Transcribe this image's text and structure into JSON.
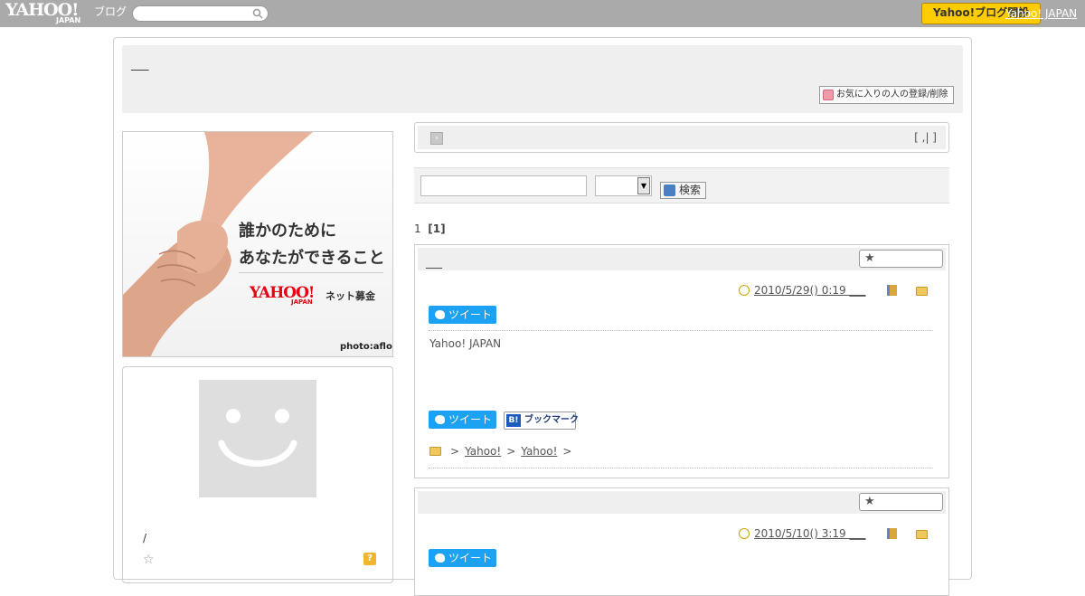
{
  "topbar": {
    "logo_text": "YAHOO!",
    "logo_sub": "JAPAN",
    "blog_label": "ブログ",
    "search_placeholder": "",
    "button_label": "Yahoo!ブログ開設",
    "link_label": "Yahoo! JAPAN"
  },
  "blog": {
    "title": "___",
    "favorite_button": "お気に入りの人の登録/削除"
  },
  "banner": {
    "line1": "誰かのために",
    "line2": "あなたができること",
    "brand": "YAHOO!",
    "brand_sub": "JAPAN",
    "service": "ネット募金",
    "credit": "photo:aflo"
  },
  "profile": {
    "name": "/",
    "help_label": "?"
  },
  "pager": {
    "arrow": "›",
    "brackets": "[ ,| ]"
  },
  "search": {
    "input_value": "",
    "select_value": "",
    "button_label": "検索"
  },
  "page_count": {
    "total": "1",
    "current": "[1]"
  },
  "entries": [
    {
      "title": "___",
      "date": "2010/5/29()  0:19 ___",
      "tweet_label": "ツイート",
      "body": "Yahoo! JAPAN",
      "bookmark_label": "ブックマーク",
      "crumb_sep": ">",
      "crumbs": [
        "Yahoo!",
        "Yahoo!"
      ]
    },
    {
      "title": "",
      "date": "2010/5/10()  3:19 ___",
      "tweet_label": "ツイート"
    }
  ]
}
